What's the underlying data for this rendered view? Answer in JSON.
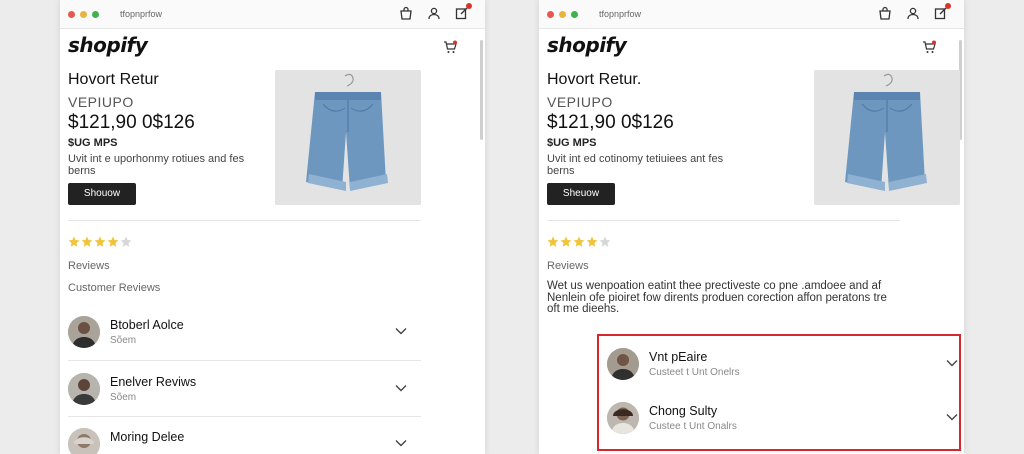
{
  "colors": {
    "dot_red": "#e8574f",
    "dot_yellow": "#e9b43a",
    "dot_green": "#3fb14d",
    "accent_badge": "#d9342b",
    "star": "#f0c43c",
    "highlight": "#d7262c"
  },
  "left": {
    "url": "tfopnprfow",
    "brand": "shopify",
    "product": {
      "title": "Hovort Retur",
      "sku": "VEPIUPO",
      "price": "$121,90 0$126",
      "stock": "$UG MPS",
      "description": "Uvit int e uporhonmy rotiues and fes berns",
      "button": "Shouow"
    },
    "rating": 4,
    "reviews_label": "Reviews",
    "customer_reviews_label": "Customer Reviews",
    "reviews": [
      {
        "name": "Btoberl Aolce",
        "sub": "Sõem"
      },
      {
        "name": "Enelver Reviws",
        "sub": "Sõem"
      },
      {
        "name": "Moring Delee",
        "sub": ""
      }
    ]
  },
  "right": {
    "url": "tfopnprfow",
    "brand": "shopify",
    "product": {
      "title": "Hovort Retur.",
      "sku": "VEPIUPO",
      "price": "$121,90 0$126",
      "stock": "$UG MPS",
      "description": "Uvit int ed cotinomy tetiuiees ant fes berns",
      "button": "Sheuow"
    },
    "rating": 4,
    "reviews_label": "Reviews",
    "paragraph": "Wet us wenpoation eatint thee prectiveste co pne .amdoee and af Nenlein ofe pioiret fow dirents produen corection affon peratons tre oft me dieehs.",
    "reviews": [
      {
        "name": "Vnt pEaire",
        "sub": "Custeet t Unt Onelrs"
      },
      {
        "name": "Chong Sulty",
        "sub": "Custee t Unt Onalrs"
      }
    ]
  }
}
